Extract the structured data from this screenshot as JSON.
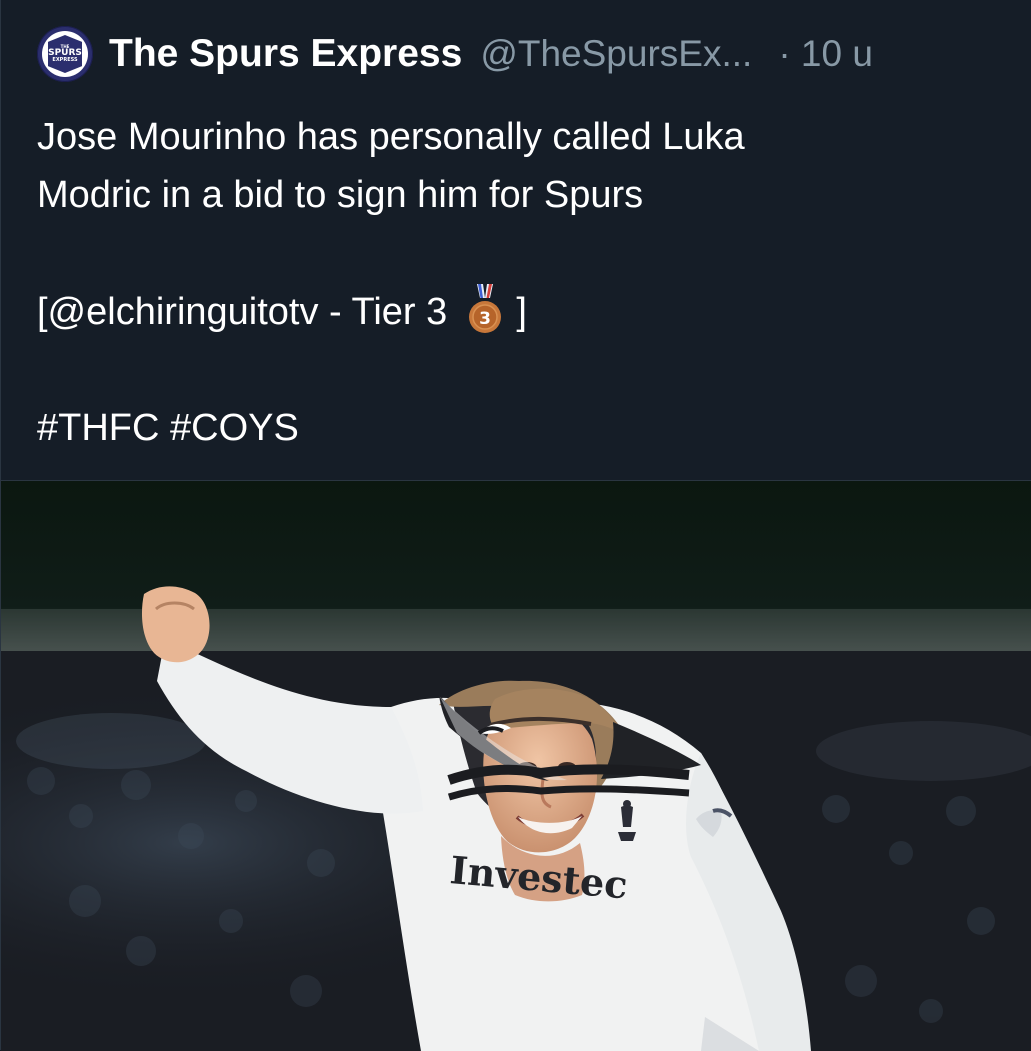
{
  "tweet": {
    "author": {
      "display_name": "The Spurs Express",
      "handle": "@TheSpursEx...",
      "avatar_text": {
        "top": "THE",
        "middle": "SPURS",
        "bottom": "EXPRESS"
      }
    },
    "timestamp": "· 10 u",
    "text": {
      "line1": "Jose Mourinho has personally called Luka",
      "line2": "Modric in a bid to sign him for Spurs",
      "source_prefix": "[@elchiringuitotv - Tier 3",
      "source_suffix": "]",
      "hashtags": "#THFC #COYS"
    },
    "media": {
      "sponsor_text": "Investec"
    }
  },
  "colors": {
    "background": "#151d27",
    "text": "#ffffff",
    "muted": "#8899a6",
    "avatar": "#2b2e6e",
    "bronze": "#b86a2a"
  },
  "icons": {
    "medal": "bronze-medal-3-icon",
    "avatar": "spurs-express-logo"
  }
}
